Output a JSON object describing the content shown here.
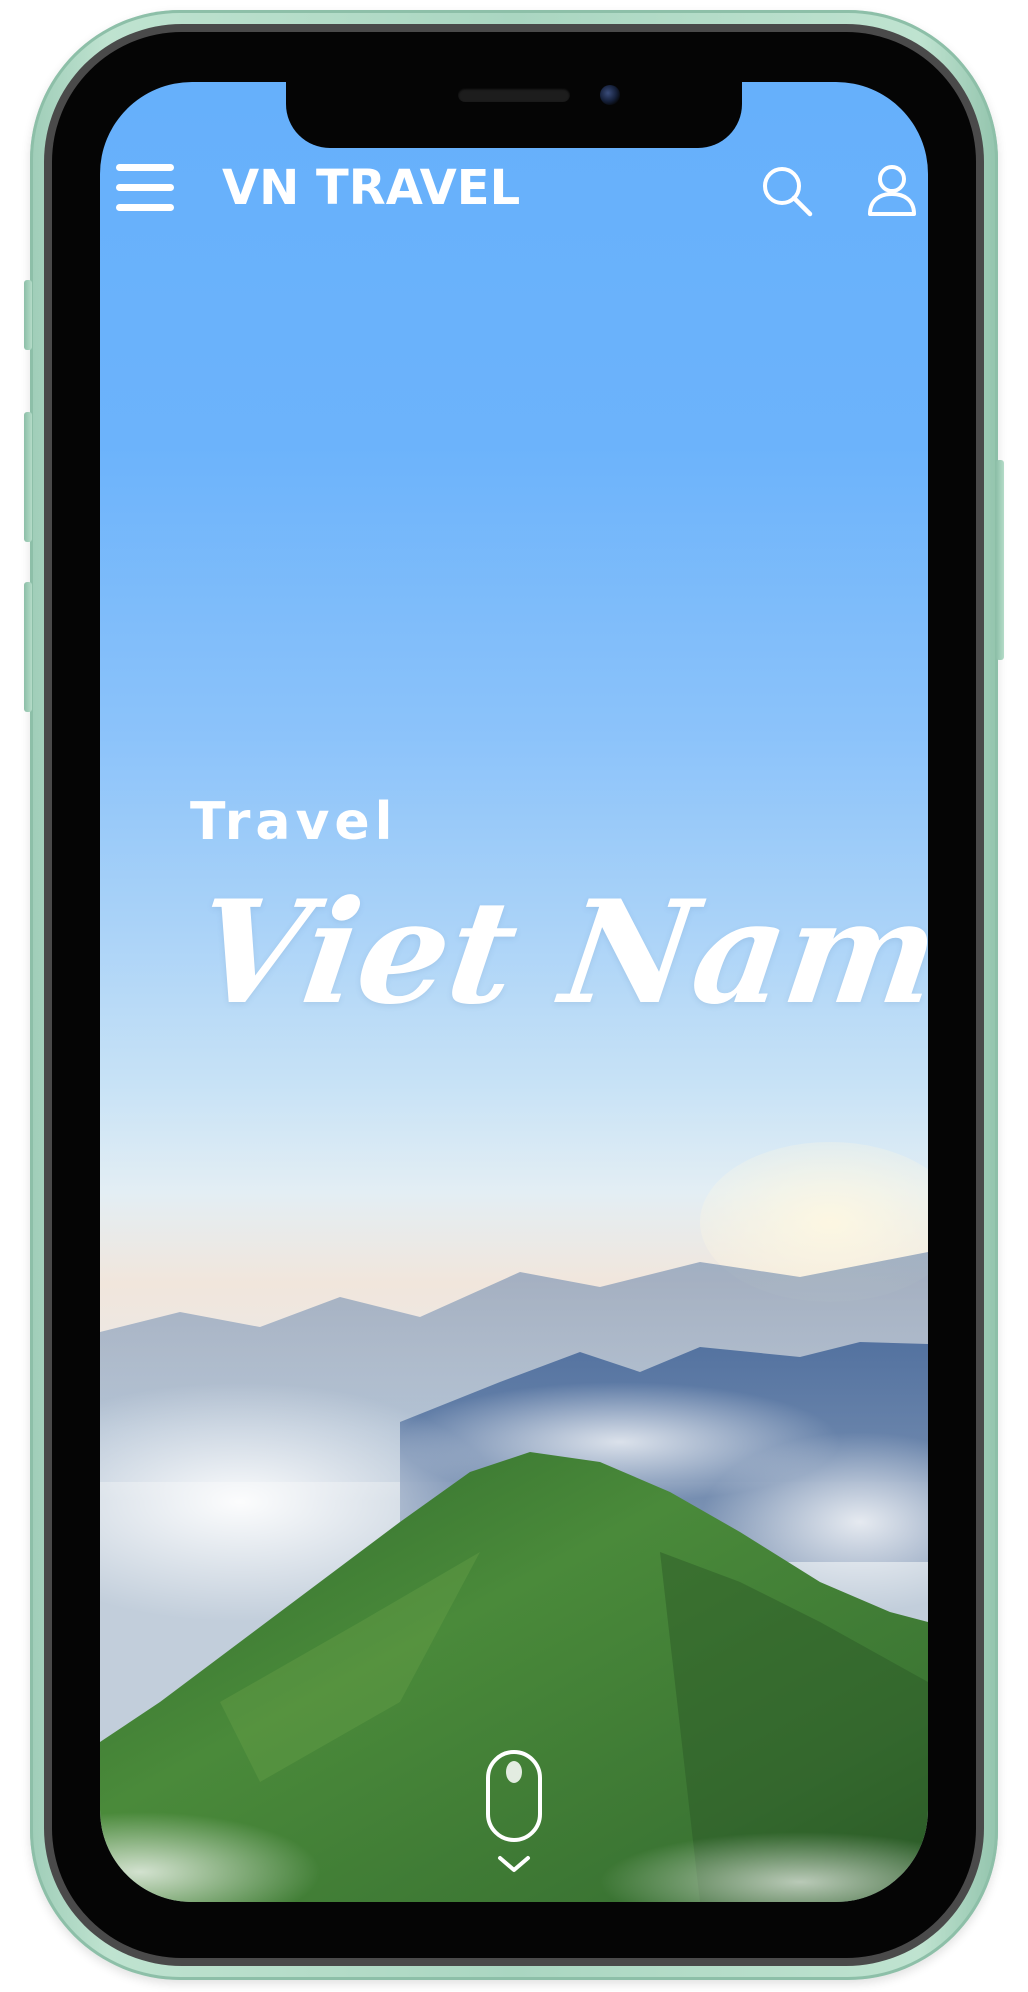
{
  "app": {
    "brand": "VN TRAVEL"
  },
  "header": {
    "menu_icon": "hamburger-menu-icon",
    "search_icon": "search-icon",
    "user_icon": "user-icon"
  },
  "hero": {
    "eyebrow": "Travel",
    "headline": "Viet Nam"
  },
  "scroll_hint": {
    "icon": "mouse-scroll-icon",
    "arrow": "chevron-down-icon"
  },
  "colors": {
    "sky_top": "#66b0fb",
    "text": "#ffffff",
    "device_frame": "#aad6c1",
    "mountain_green": "#3f7a34"
  }
}
